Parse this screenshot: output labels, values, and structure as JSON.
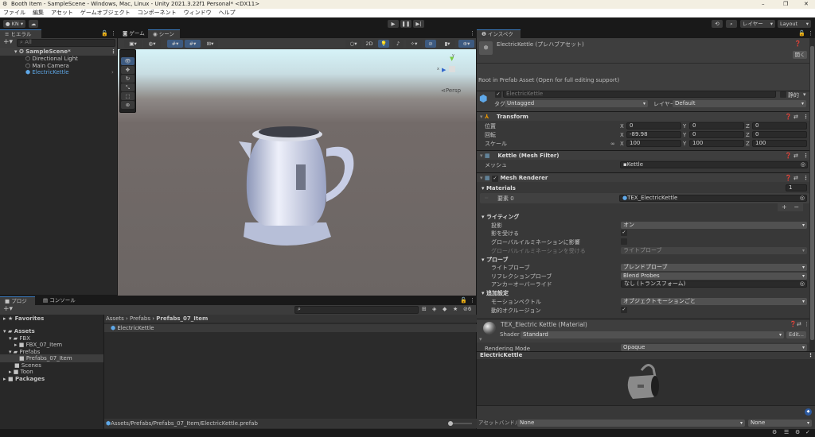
{
  "window": {
    "title": "Booth Item - SampleScene - Windows, Mac, Linux - Unity 2021.3.22f1 Personal* <DX11>",
    "minimize": "–",
    "maximize": "❐",
    "close": "✕"
  },
  "menu": [
    "ファイル",
    "編集",
    "アセット",
    "ゲームオブジェクト",
    "コンポーネント",
    "ウィンドウ",
    "ヘルプ"
  ],
  "toolbar": {
    "account": "KN",
    "layers": "レイヤー",
    "layout": "Layout"
  },
  "hierarchy": {
    "tab": "ヒエラルキー",
    "search_placeholder": "All",
    "scene": "SampleScene*",
    "items": [
      "Directional Light",
      "Main Camera",
      "ElectricKettle"
    ]
  },
  "scene_view": {
    "tabs": [
      "ゲーム",
      "シーン"
    ],
    "mode_2d": "2D",
    "persp": "Persp",
    "gizmo_x": "x",
    "gizmo_y": "y"
  },
  "project": {
    "tabs": [
      "プロジェクト",
      "コンソール"
    ],
    "tree": [
      "Favorites",
      "Assets",
      "FBX",
      "FBX_07_Item",
      "Prefabs",
      "Prefabs_07_Item",
      "Scenes",
      "Toon",
      "Packages"
    ],
    "breadcrumb": [
      "Assets",
      "Prefabs",
      "Prefabs_07_Item"
    ],
    "files": [
      "ElectricKettle"
    ],
    "path": "Assets/Prefabs/Prefabs_07_Item/ElectricKettle.prefab",
    "hidden_count": "6"
  },
  "inspector": {
    "tab": "インスペクター",
    "title": "ElectricKettle (プレハブアセット)",
    "open": "開く",
    "root_note": "Root in Prefab Asset (Open for full editing support)",
    "name": "ElectricKettle",
    "static": "静的",
    "tag_label": "タグ",
    "tag": "Untagged",
    "layer_label": "レイヤー",
    "layer": "Default",
    "transform": {
      "title": "Transform",
      "position_label": "位置",
      "rotation_label": "回転",
      "scale_label": "スケール",
      "position": [
        "0",
        "0",
        "0"
      ],
      "rotation": [
        "-89.98",
        "0",
        "0"
      ],
      "scale": [
        "100",
        "100",
        "100"
      ]
    },
    "mesh_filter": {
      "title": "Kettle (Mesh Filter)",
      "mesh_label": "メッシュ",
      "mesh": "Kettle"
    },
    "mesh_renderer": {
      "title": "Mesh Renderer",
      "materials": "Materials",
      "count": "1",
      "element_label": "要素 0",
      "element": "TEX_ElectricKettle",
      "lighting": "ライティング",
      "cast_label": "投影",
      "cast": "オン",
      "receive_label": "影を受ける",
      "gi_label": "グローバルイルミネーションに影響",
      "receive_gi_label": "グローバルイルミネーションを受ける",
      "receive_gi": "ライトプローブ",
      "probes": "プローブ",
      "light_probe_label": "ライトプローブ",
      "light_probe": "ブレンドプローブ",
      "reflection_label": "リフレクションプローブ",
      "reflection": "Blend Probes",
      "anchor_label": "アンカーオーバーライド",
      "anchor": "なし (トランスフォーム)",
      "additional": "追加設定",
      "motion_label": "モーションベクトル",
      "motion": "オブジェクトモーションごと",
      "occlusion_label": "動的オクルージョン"
    },
    "material": {
      "title": "TEX_Electric Kettle (Material)",
      "shader_label": "Shader",
      "shader": "Standard",
      "edit": "Edit...",
      "rendering_mode_label": "Rendering Mode",
      "rendering_mode": "Opaque"
    },
    "preview": {
      "title": "ElectricKettle"
    },
    "asset_bundle": {
      "label": "アセットバンドル",
      "name": "None",
      "variant": "None"
    }
  },
  "colors": {
    "accent": "#3a79bb",
    "selected_text": "#5fa8e8"
  }
}
